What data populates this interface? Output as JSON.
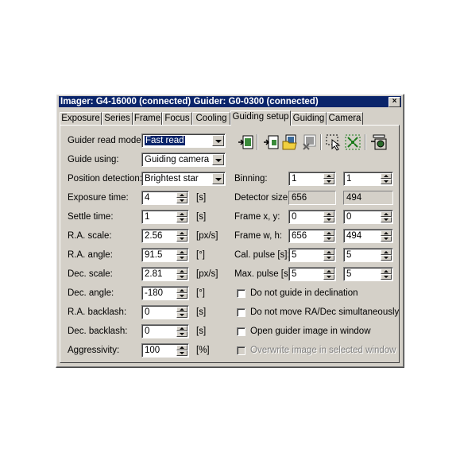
{
  "window": {
    "title": "Imager: G4-16000 (connected) Guider: G0-0300 (connected)",
    "close_label": "×"
  },
  "tabs": [
    {
      "label": "Exposure"
    },
    {
      "label": "Series"
    },
    {
      "label": "Frame"
    },
    {
      "label": "Focus"
    },
    {
      "label": "Cooling"
    },
    {
      "label": "Guiding setup",
      "active": true
    },
    {
      "label": "Guiding"
    },
    {
      "label": "Camera"
    }
  ],
  "left": {
    "read_mode": {
      "label": "Guider read mode:",
      "value": "Fast read"
    },
    "guide_using": {
      "label": "Guide using:",
      "value": "Guiding camera"
    },
    "position_detection": {
      "label": "Position detection:",
      "value": "Brightest star"
    },
    "exposure_time": {
      "label": "Exposure time:",
      "value": "4",
      "unit": "[s]"
    },
    "settle_time": {
      "label": "Settle time:",
      "value": "1",
      "unit": "[s]"
    },
    "ra_scale": {
      "label": "R.A. scale:",
      "value": "2.56",
      "unit": "[px/s]"
    },
    "ra_angle": {
      "label": "R.A. angle:",
      "value": "91.5",
      "unit": "[°]"
    },
    "dec_scale": {
      "label": "Dec. scale:",
      "value": "2.81",
      "unit": "[px/s]"
    },
    "dec_angle": {
      "label": "Dec. angle:",
      "value": "-180",
      "unit": "[°]"
    },
    "ra_backlash": {
      "label": "R.A. backlash:",
      "value": "0",
      "unit": "[s]"
    },
    "dec_backlash": {
      "label": "Dec. backlash:",
      "value": "0",
      "unit": "[s]"
    },
    "aggressivity": {
      "label": "Aggressivity:",
      "value": "100",
      "unit": "[%]"
    }
  },
  "right": {
    "binning": {
      "label": "Binning:",
      "x": "1",
      "y": "1"
    },
    "detector_size": {
      "label": "Detector size:",
      "w": "656",
      "h": "494"
    },
    "frame_xy": {
      "label": "Frame x, y:",
      "x": "0",
      "y": "0"
    },
    "frame_wh": {
      "label": "Frame w, h:",
      "w": "656",
      "h": "494"
    },
    "cal_pulse": {
      "label": "Cal. pulse [s]:",
      "a": "5",
      "b": "5"
    },
    "max_pulse": {
      "label": "Max. pulse [s]:",
      "a": "5",
      "b": "5"
    },
    "checks": [
      {
        "label": "Do not guide in declination",
        "checked": false
      },
      {
        "label": "Do not move RA/Dec simultaneously",
        "checked": false
      },
      {
        "label": "Open guider image in window",
        "checked": false
      },
      {
        "label": "Overwrite image in selected window",
        "checked": false,
        "disabled": true
      }
    ]
  },
  "toolbar": {
    "icons": [
      "download-frame-icon",
      "download-region-icon",
      "open-folder-image-icon",
      "clear-image-icon",
      "select-star-icon",
      "auto-select-icon",
      "capture-icon"
    ]
  },
  "colors": {
    "face": "#d4d0c8",
    "title": "#0a246a",
    "highlight": "#0a246a"
  }
}
